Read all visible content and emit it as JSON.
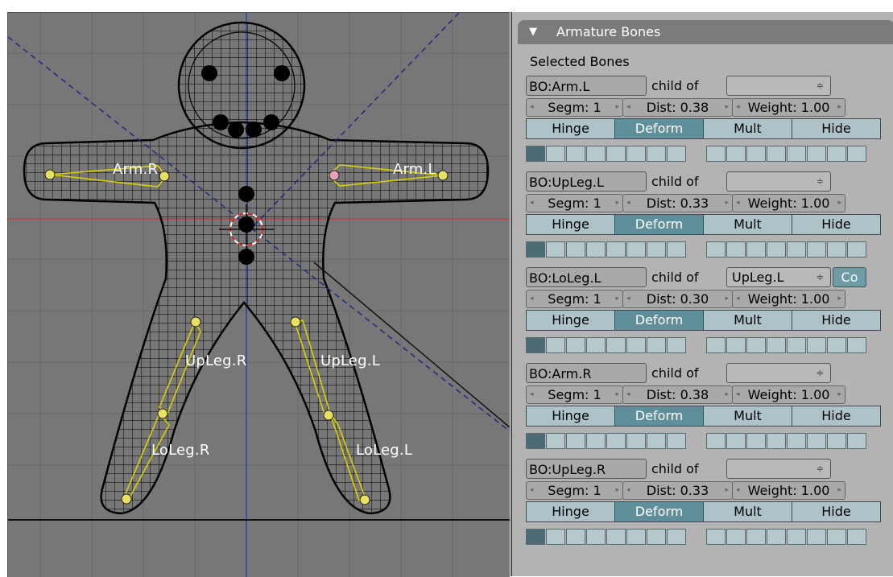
{
  "panel": {
    "title": "Armature Bones",
    "header_icon": "triangle-down-icon",
    "selected_label": "Selected Bones"
  },
  "viewport": {
    "bone_labels": [
      "Arm.R",
      "Arm.L",
      "UpLeg.R",
      "UpLeg.L",
      "LoLeg.R",
      "LoLeg.L"
    ]
  },
  "bones": [
    {
      "name": "BO:Arm.L",
      "child_of": "child of",
      "parent": "",
      "co": "",
      "segm": "Segm: 1",
      "dist": "Dist: 0.38",
      "weight": "Weight: 1.00",
      "hinge": "Hinge",
      "deform": "Deform",
      "mult": "Mult",
      "hide": "Hide"
    },
    {
      "name": "BO:UpLeg.L",
      "child_of": "child of",
      "parent": "",
      "co": "",
      "segm": "Segm: 1",
      "dist": "Dist: 0.33",
      "weight": "Weight: 1.00",
      "hinge": "Hinge",
      "deform": "Deform",
      "mult": "Mult",
      "hide": "Hide"
    },
    {
      "name": "BO:LoLeg.L",
      "child_of": "child of",
      "parent": "UpLeg.L",
      "co": "Co",
      "segm": "Segm: 1",
      "dist": "Dist: 0.30",
      "weight": "Weight: 1.00",
      "hinge": "Hinge",
      "deform": "Deform",
      "mult": "Mult",
      "hide": "Hide"
    },
    {
      "name": "BO:Arm.R",
      "child_of": "child of",
      "parent": "",
      "co": "",
      "segm": "Segm: 1",
      "dist": "Dist: 0.38",
      "weight": "Weight: 1.00",
      "hinge": "Hinge",
      "deform": "Deform",
      "mult": "Mult",
      "hide": "Hide"
    },
    {
      "name": "BO:UpLeg.R",
      "child_of": "child of",
      "parent": "",
      "co": "",
      "segm": "Segm: 1",
      "dist": "Dist: 0.33",
      "weight": "Weight: 1.00",
      "hinge": "Hinge",
      "deform": "Deform",
      "mult": "Mult",
      "hide": "Hide"
    }
  ],
  "colors": {
    "viewport_bg": "#777777",
    "panel_bg": "#b3b3b3",
    "toggle_on": "#5f8f9a",
    "toggle_off": "#aec3c8",
    "bone_outline": "#d8d000",
    "x_axis": "#b84040",
    "y_axis": "#3040b0"
  }
}
